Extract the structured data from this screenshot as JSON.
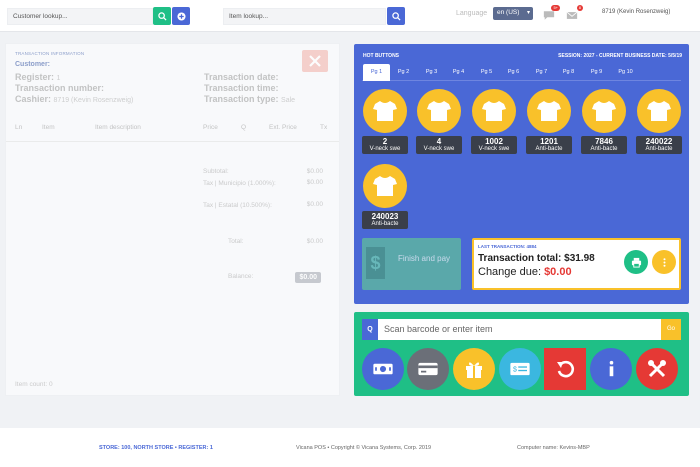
{
  "topbar": {
    "customer_placeholder": "Customer lookup...",
    "item_placeholder": "Item lookup...",
    "language_label": "Language",
    "language_value": "en (US)",
    "messages_badge": "5+",
    "alerts_badge": "8",
    "user": "8719 (Kevin Rosenzweig)",
    "icons": [
      "search-icon",
      "add-icon",
      "search-icon",
      "chat-icon",
      "inbox-icon"
    ]
  },
  "transaction": {
    "header": "TRANSACTION INFORMATION",
    "customer_label": "Customer:",
    "register_label": "Register:",
    "register_value": "1",
    "number_label": "Transaction number:",
    "cashier_label": "Cashier:",
    "cashier_value": "8719 (Kevin Rosenzweig)",
    "date_label": "Transaction date:",
    "time_label": "Transaction time:",
    "type_label": "Transaction type:",
    "type_value": "Sale",
    "columns": [
      "Ln",
      "Item",
      "Item description",
      "Price",
      "Q",
      "Ext. Price",
      "Tx"
    ],
    "subtotal_label": "Subtotal:",
    "subtotal_value": "$0.00",
    "tax_municipio_label": "Tax | Municipio (1.000%):",
    "tax_municipio_value": "$0.00",
    "tax_estatal_label": "Tax | Estatal (10.500%):",
    "tax_estatal_value": "$0.00",
    "total_label": "Total:",
    "total_value": "$0.00",
    "balance_label": "Balance:",
    "balance_value": "$0.00",
    "item_count": "Item count: 0"
  },
  "hot": {
    "title": "HOT BUTTONS",
    "session": "SESSION: 2027 - CURRENT BUSINESS DATE: 5/5/19",
    "tabs": [
      "Pg 1",
      "Pg 2",
      "Pg 3",
      "Pg 4",
      "Pg 5",
      "Pg 6",
      "Pg 7",
      "Pg 8",
      "Pg 9",
      "Pg 10"
    ],
    "active_tab": 0,
    "items": [
      {
        "code": "2",
        "name": "V-neck swe"
      },
      {
        "code": "4",
        "name": "V-neck swe"
      },
      {
        "code": "1002",
        "name": "V-neck swe"
      },
      {
        "code": "1201",
        "name": "Anti-bacte"
      },
      {
        "code": "7846",
        "name": "Anti-bacte"
      },
      {
        "code": "240022",
        "name": "Anti-bacte"
      },
      {
        "code": "240023",
        "name": "Anti-bacte"
      }
    ],
    "finish_label": "Finish and pay",
    "last_label": "LAST TRANSACTION: 4884",
    "last_total_label": "Transaction total:",
    "last_total_value": "$31.98",
    "change_label": "Change due:",
    "change_value": "$0.00"
  },
  "scan": {
    "q_label": "Q",
    "placeholder": "Scan barcode or enter item",
    "go_label": "Go",
    "buttons": [
      "cash-icon",
      "card-icon",
      "gift-icon",
      "check-icon",
      "undo-icon",
      "info-icon",
      "tools-icon"
    ]
  },
  "footer": {
    "store": "STORE: 100, NORTH STORE • REGISTER: 1",
    "copyright": "Vicana POS • Copyright © Vicana Systems, Corp. 2019",
    "computer": "Computer name: Kevins-MBP"
  },
  "colors": {
    "hot_bg": "#4a68d6",
    "scan_bg": "#1fbf86",
    "accent_yellow": "#f9c12a",
    "danger": "#e53935",
    "search_green": "#1fbf86"
  }
}
